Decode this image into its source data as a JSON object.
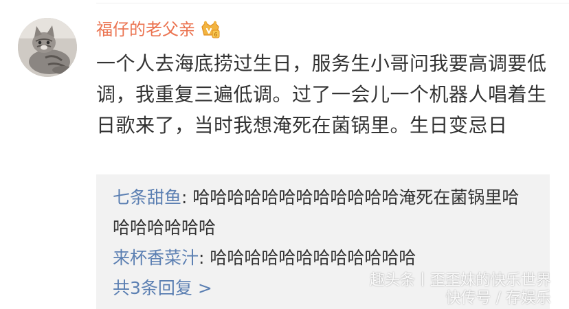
{
  "post": {
    "username": "福仔的老父亲",
    "avatar_icon": "cat-avatar",
    "badge_icon": "vip-crown-icon",
    "text": "一个人去海底捞过生日，服务生小哥问我要高调要低调，我重复三遍低调。过了一会儿一个机器人唱着生日歌来了，当时我想淹死在菌锅里。生日变忌日"
  },
  "replies": {
    "items": [
      {
        "user": "七条甜鱼",
        "separator": ": ",
        "text": "哈哈哈哈哈哈哈哈哈哈哈哈淹死在菌锅里哈哈哈哈哈哈哈"
      },
      {
        "user": "来杯香菜汁",
        "separator": ": ",
        "text": "哈哈哈哈哈哈哈哈哈哈哈哈"
      }
    ],
    "more_label": "共3条回复 >"
  },
  "watermark": {
    "line1": "趣头条丨歪歪妹的快乐世界",
    "line2": "快传号 / 存娱乐"
  },
  "colors": {
    "username": "#eb7350",
    "reply_user": "#5b7fb2",
    "reply_bg": "#f2f2f2",
    "text": "#333333"
  }
}
